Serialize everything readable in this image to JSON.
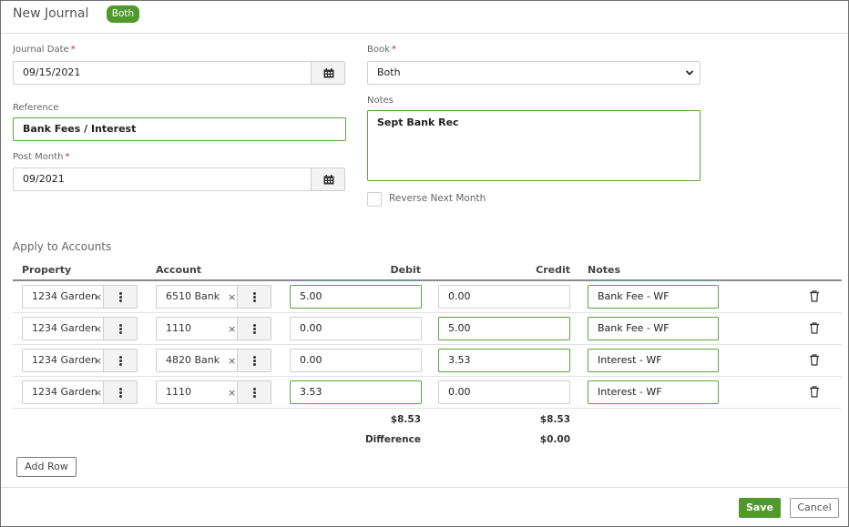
{
  "header": {
    "title": "New Journal",
    "badge": "Both"
  },
  "form": {
    "journal_date": {
      "label": "Journal Date",
      "value": "09/15/2021"
    },
    "reference": {
      "label": "Reference",
      "value": "Bank Fees / Interest"
    },
    "post_month": {
      "label": "Post Month",
      "value": "09/2021"
    },
    "book": {
      "label": "Book",
      "value": "Both"
    },
    "notes": {
      "label": "Notes",
      "value": "Sept Bank Rec"
    },
    "reverse_next_month": {
      "label": "Reverse Next Month",
      "checked": false
    },
    "required_marker": "*"
  },
  "accounts": {
    "title": "Apply to Accounts",
    "columns": {
      "property": "Property",
      "account": "Account",
      "debit": "Debit",
      "credit": "Credit",
      "notes": "Notes"
    },
    "rows": [
      {
        "property": "1234 Garden",
        "account": "6510 Bank",
        "debit": "5.00",
        "credit": "0.00",
        "notes": "Bank Fee - WF"
      },
      {
        "property": "1234 Garden",
        "account": "1110",
        "debit": "0.00",
        "credit": "5.00",
        "notes": "Bank Fee - WF"
      },
      {
        "property": "1234 Garden",
        "account": "4820 Bank",
        "debit": "0.00",
        "credit": "3.53",
        "notes": "Interest - WF"
      },
      {
        "property": "1234 Garden",
        "account": "1110",
        "debit": "3.53",
        "credit": "0.00",
        "notes": "Interest - WF"
      }
    ],
    "clear_glyph": "×",
    "totals": {
      "debit": "$8.53",
      "credit": "$8.53",
      "difference_label": "Difference",
      "difference": "$0.00"
    },
    "add_row_label": "Add Row"
  },
  "footer": {
    "save_label": "Save",
    "cancel_label": "Cancel"
  },
  "colors": {
    "accent": "#4f9a2a",
    "required": "#c0282d",
    "field_focus_border": "#5aa43a"
  },
  "icons": {
    "date_picker": "calendar-icon",
    "book_select": "chevron-down-icon",
    "row_actions": "more-vertical-icon",
    "row_delete": "trash-icon"
  }
}
